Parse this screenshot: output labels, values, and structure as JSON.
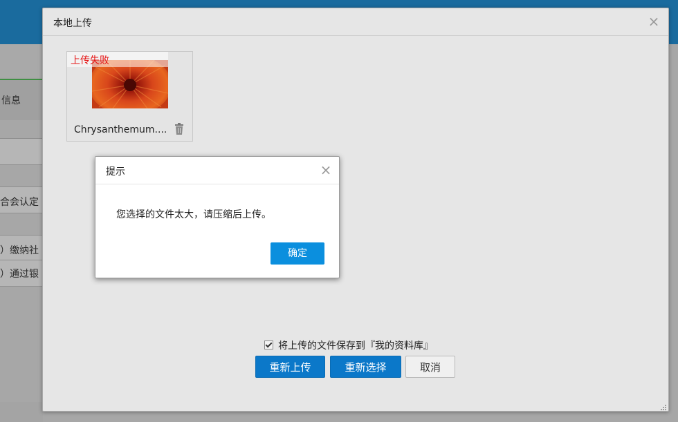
{
  "background": {
    "partial_labels": [
      "信息",
      "合会认定",
      "）缴纳社",
      "）通过银"
    ]
  },
  "upload_dialog": {
    "title": "本地上传",
    "close_symbol": "×",
    "file": {
      "status": "上传失败",
      "name": "Chrysanthemum....",
      "status_color": "#e51515"
    },
    "save_to_library_label": "将上传的文件保存到『我的资料库』",
    "save_to_library_checked": true,
    "buttons": {
      "reupload": "重新上传",
      "reselect": "重新选择",
      "cancel": "取消"
    }
  },
  "alert_dialog": {
    "title": "提示",
    "close_symbol": "×",
    "message": "您选择的文件太大，请压缩后上传。",
    "ok_label": "确定"
  },
  "colors": {
    "primary": "#0b78c9",
    "alert_ok": "#0b8fde",
    "header_bar": "#1a6b9e"
  }
}
